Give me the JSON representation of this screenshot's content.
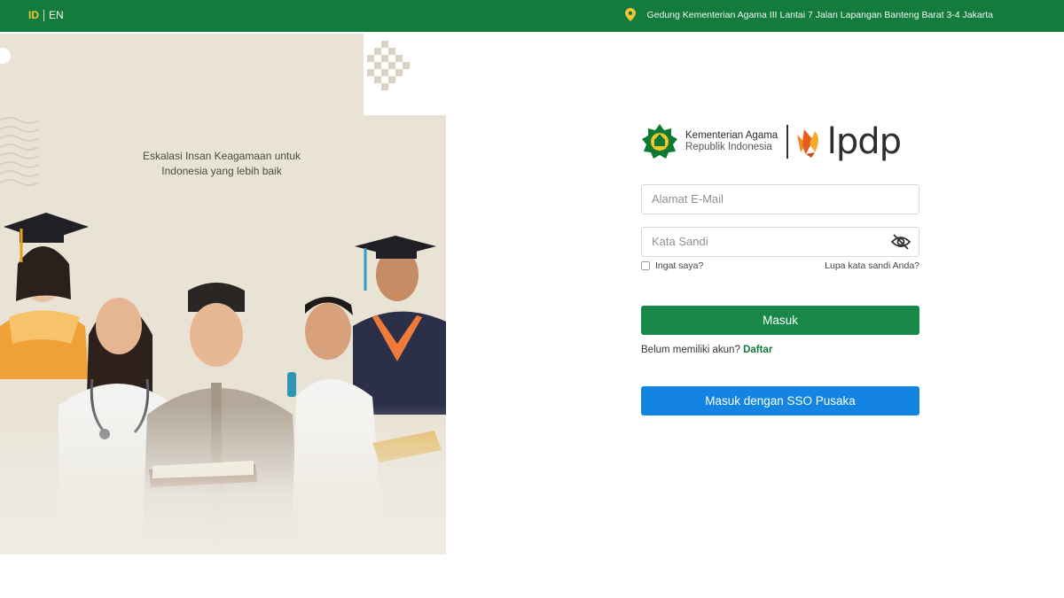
{
  "topbar": {
    "lang_active": "ID",
    "lang_other": "EN",
    "address": "Gedung Kementerian Agama III Lantai 7 Jalan Lapangan Banteng Barat 3-4 Jakarta",
    "color": "#137c3c"
  },
  "hero": {
    "tagline_line1": "Eskalasi Insan Keagamaan untuk",
    "tagline_line2": "Indonesia yang lebih baik"
  },
  "brand": {
    "org_line1": "Kementerian Agama",
    "org_line2": "Republik Indonesia",
    "partner": "lpdp"
  },
  "form": {
    "email_placeholder": "Alamat E-Mail",
    "password_placeholder": "Kata Sandi",
    "remember_label": "Ingat saya?",
    "forgot_label": "Lupa kata sandi Anda?",
    "submit_label": "Masuk",
    "register_prompt": "Belum memiliki akun?",
    "register_link": "Daftar",
    "sso_label": "Masuk dengan SSO Pusaka"
  },
  "colors": {
    "primary_green": "#178847",
    "sso_blue": "#1484e3",
    "accent_yellow": "#f3c534",
    "hero_bg": "#e9e3d5"
  }
}
